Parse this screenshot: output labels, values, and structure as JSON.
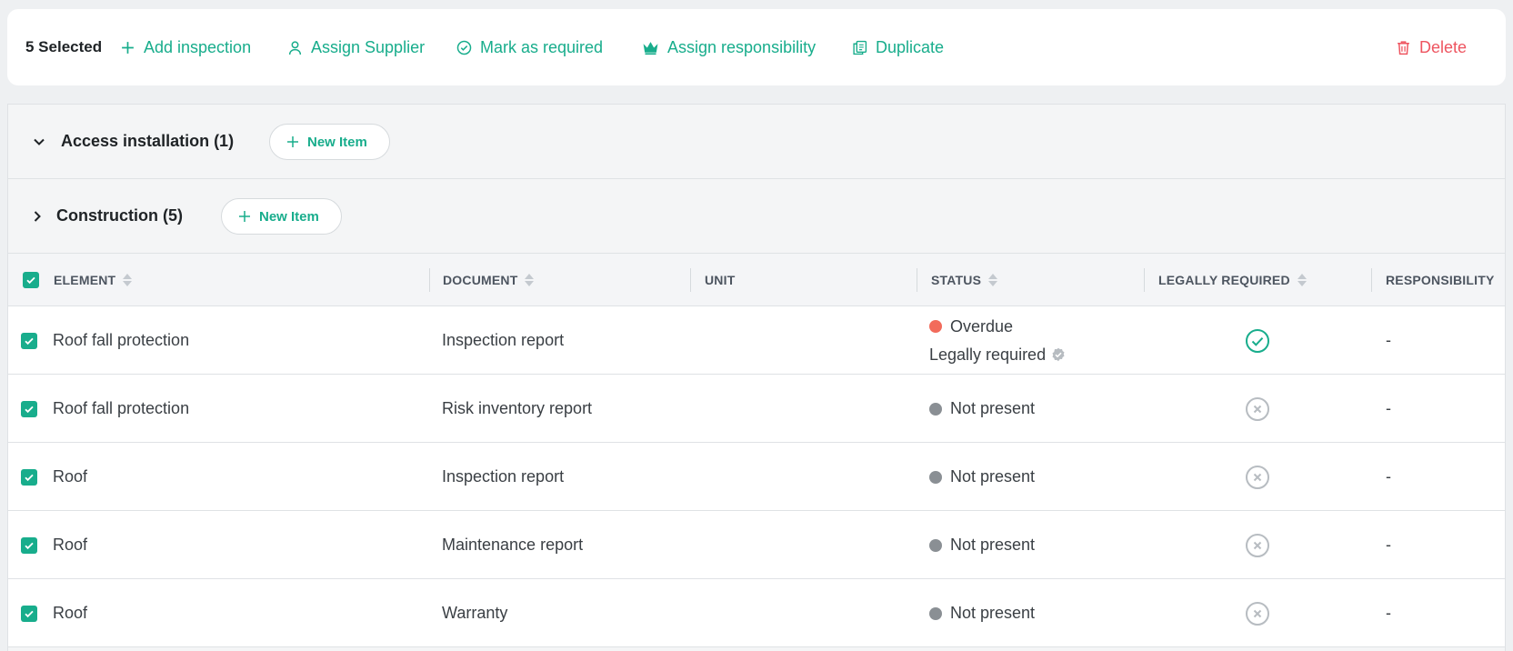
{
  "action_bar": {
    "selected_label": "5 Selected",
    "actions": {
      "add_inspection": "Add inspection",
      "assign_supplier": "Assign Supplier",
      "mark_required": "Mark as required",
      "assign_responsibility": "Assign responsibility",
      "duplicate": "Duplicate",
      "delete": "Delete"
    }
  },
  "groups": [
    {
      "title": "Access installation (1)",
      "expanded": true,
      "new_item_label": "New Item"
    },
    {
      "title": "Construction (5)",
      "expanded": false,
      "new_item_label": "New Item"
    }
  ],
  "table": {
    "headers": {
      "element": "ELEMENT",
      "document": "DOCUMENT",
      "unit": "UNIT",
      "status": "STATUS",
      "legally_required": "LEGALLY REQUIRED",
      "responsibility": "RESPONSIBILITY"
    },
    "rows": [
      {
        "element": "Roof fall protection",
        "document": "Inspection report",
        "unit": "",
        "status": "Overdue",
        "status_sub": "Legally required",
        "legally_required": true,
        "responsibility": "-"
      },
      {
        "element": "Roof fall protection",
        "document": "Risk inventory report",
        "unit": "",
        "status": "Not present",
        "legally_required": false,
        "responsibility": "-"
      },
      {
        "element": "Roof",
        "document": "Inspection report",
        "unit": "",
        "status": "Not present",
        "legally_required": false,
        "responsibility": "-"
      },
      {
        "element": "Roof",
        "document": "Maintenance report",
        "unit": "",
        "status": "Not present",
        "legally_required": false,
        "responsibility": "-"
      },
      {
        "element": "Roof",
        "document": "Warranty",
        "unit": "",
        "status": "Not present",
        "legally_required": false,
        "responsibility": "-"
      }
    ]
  },
  "colors": {
    "accent": "#18ad8c",
    "danger": "#ee5560",
    "overdue": "#f26b5b",
    "not_present": "#8a8f94",
    "icon_muted": "#b7bcc1"
  }
}
